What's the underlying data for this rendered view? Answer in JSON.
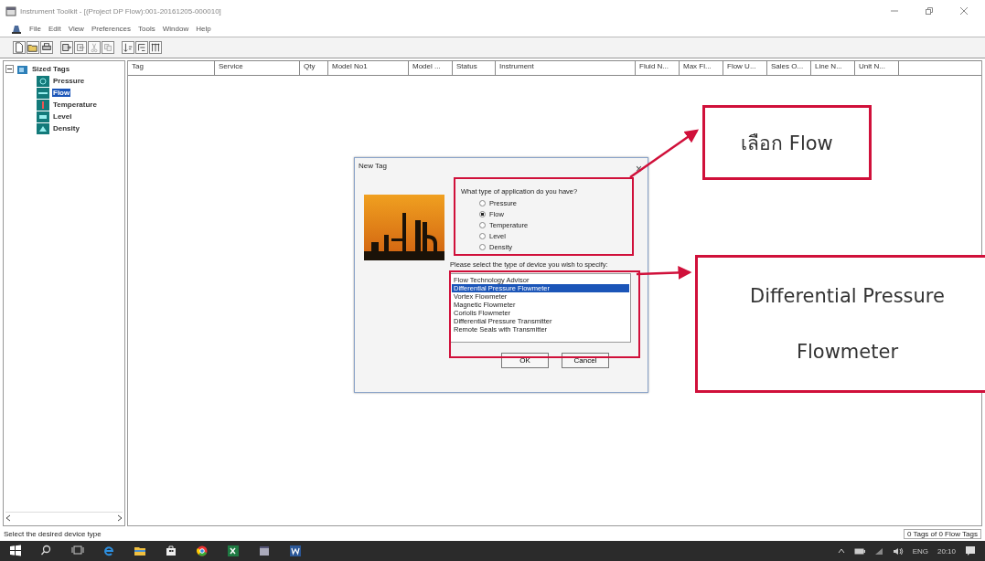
{
  "window": {
    "title": "Instrument Toolkit - [(Project DP Flow):001-20161205-000010]"
  },
  "menu": [
    "File",
    "Edit",
    "View",
    "Preferences",
    "Tools",
    "Window",
    "Help"
  ],
  "tree": {
    "label": "Sized Tags",
    "expanded": true,
    "children": [
      {
        "label": "Pressure",
        "selected": false
      },
      {
        "label": "Flow",
        "selected": true
      },
      {
        "label": "Temperature",
        "selected": false
      },
      {
        "label": "Level",
        "selected": false
      },
      {
        "label": "Density",
        "selected": false
      }
    ]
  },
  "table": {
    "columns": [
      "Tag",
      "Service",
      "Qty",
      "Model No1",
      "Model ...",
      "Status",
      "Instrument",
      "Fluid N...",
      "Max Fl...",
      "Flow U...",
      "Sales O...",
      "Line N...",
      "Unit N..."
    ]
  },
  "dialog": {
    "title": "New Tag",
    "close": "×",
    "question": "What type of application do you have?",
    "options": [
      {
        "label": "Pressure",
        "selected": false
      },
      {
        "label": "Flow",
        "selected": true
      },
      {
        "label": "Temperature",
        "selected": false
      },
      {
        "label": "Level",
        "selected": false
      },
      {
        "label": "Density",
        "selected": false
      }
    ],
    "list_label": "Please select the type of device you wish to specify:",
    "devices": [
      {
        "label": "Flow Technology Advisor",
        "selected": false
      },
      {
        "label": "Differential Pressure Flowmeter",
        "selected": true
      },
      {
        "label": "Vortex Flowmeter",
        "selected": false
      },
      {
        "label": "Magnetic Flowmeter",
        "selected": false
      },
      {
        "label": "Coriolis Flowmeter",
        "selected": false
      },
      {
        "label": "Differential Pressure Transmitter",
        "selected": false
      },
      {
        "label": "Remote Seals with Transmitter",
        "selected": false
      }
    ],
    "buttons": [
      "OK",
      "Cancel"
    ]
  },
  "annotations": [
    {
      "text": "เลือก Flow"
    },
    {
      "text": "Differential Pressure Flowmeter"
    }
  ],
  "status_bar": {
    "message": "Select the desired device type",
    "count": "0 Tags of 0 Flow Tags"
  },
  "taskbar": {
    "language": "ENG",
    "time": "20:10"
  }
}
